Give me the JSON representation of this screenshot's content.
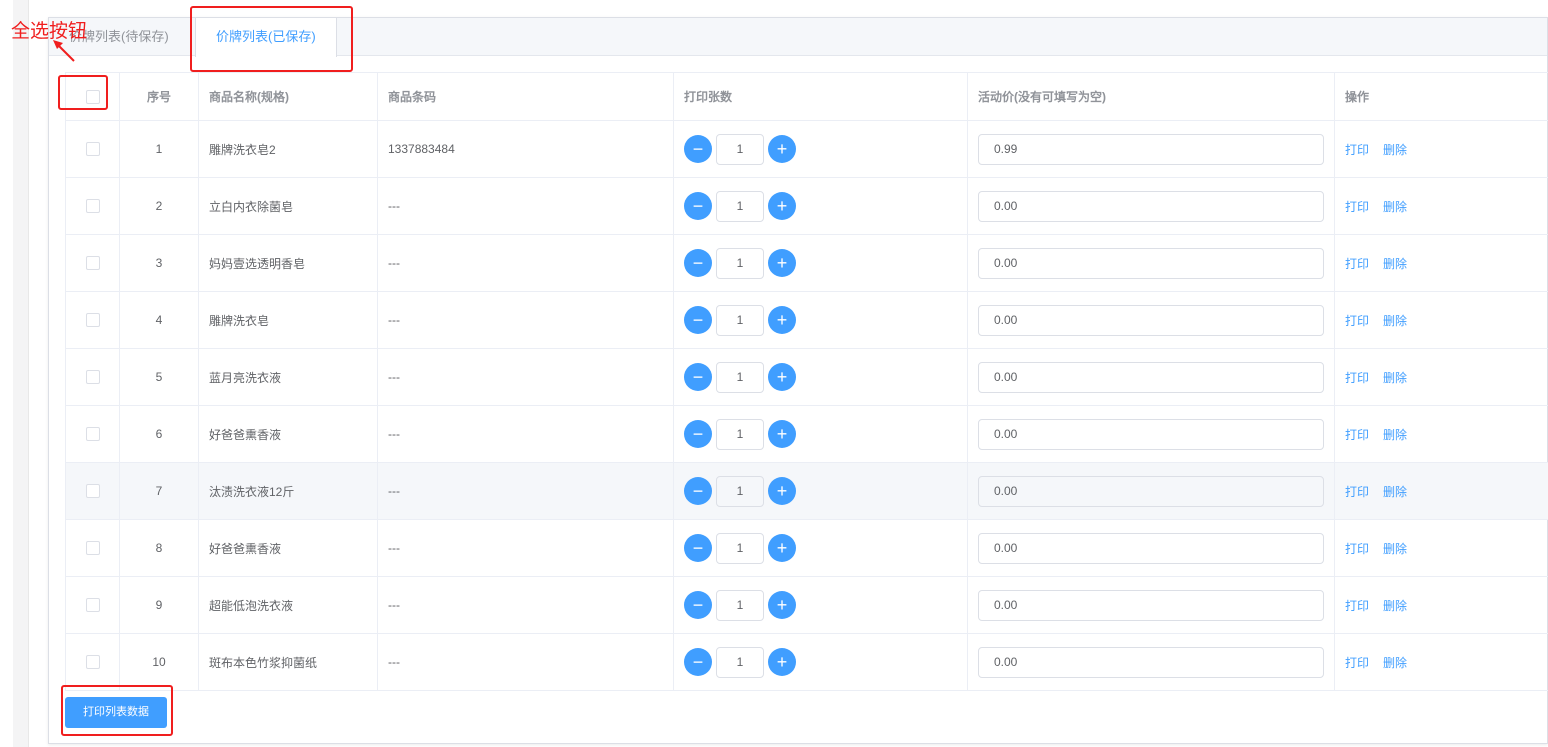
{
  "tabs": [
    {
      "label": "价牌列表(待保存)",
      "active": false
    },
    {
      "label": "价牌列表(已保存)",
      "active": true
    }
  ],
  "table": {
    "headers": [
      "",
      "序号",
      "商品名称(规格)",
      "商品条码",
      "打印张数",
      "活动价(没有可填写为空)",
      "操作"
    ],
    "rows": [
      {
        "index": "1",
        "name": "雕牌洗衣皂2",
        "barcode": "1337883484",
        "qty": "1",
        "price": "0.99"
      },
      {
        "index": "2",
        "name": "立白内衣除菌皂",
        "barcode": "---",
        "qty": "1",
        "price": "0.00"
      },
      {
        "index": "3",
        "name": "妈妈壹选透明香皂",
        "barcode": "---",
        "qty": "1",
        "price": "0.00"
      },
      {
        "index": "4",
        "name": "雕牌洗衣皂",
        "barcode": "---",
        "qty": "1",
        "price": "0.00"
      },
      {
        "index": "5",
        "name": "蓝月亮洗衣液",
        "barcode": "---",
        "qty": "1",
        "price": "0.00"
      },
      {
        "index": "6",
        "name": "好爸爸熏香液",
        "barcode": "---",
        "qty": "1",
        "price": "0.00"
      },
      {
        "index": "7",
        "name": "汰渍洗衣液12斤",
        "barcode": "---",
        "qty": "1",
        "price": "0.00"
      },
      {
        "index": "8",
        "name": "好爸爸熏香液",
        "barcode": "---",
        "qty": "1",
        "price": "0.00"
      },
      {
        "index": "9",
        "name": "超能低泡洗衣液",
        "barcode": "---",
        "qty": "1",
        "price": "0.00"
      },
      {
        "index": "10",
        "name": "斑布本色竹浆抑菌纸",
        "barcode": "---",
        "qty": "1",
        "price": "0.00"
      }
    ],
    "actions": {
      "print": "打印",
      "delete": "删除"
    },
    "stepper": {
      "minus": "−",
      "plus": "+"
    }
  },
  "print_list_button": "打印列表数据",
  "annotation": {
    "label": "全选按钮",
    "color": "#f01e1e"
  },
  "accent": "#409eff"
}
